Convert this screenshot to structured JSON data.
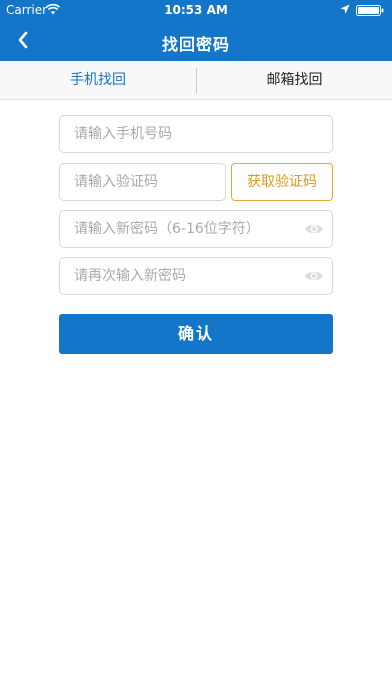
{
  "status_bar": {
    "carrier": "Carrier",
    "time": "10:53 AM",
    "icons": [
      "wifi-icon",
      "location-arrow-icon",
      "battery-icon"
    ]
  },
  "nav": {
    "title": "找回密码",
    "back_icon": "chevron-left-icon"
  },
  "tabs": [
    {
      "label": "手机找回",
      "active": true
    },
    {
      "label": "邮箱找回",
      "active": false
    }
  ],
  "form": {
    "phone_placeholder": "请输入手机号码",
    "code_placeholder": "请输入验证码",
    "get_code_label": "获取验证码",
    "new_password_placeholder": "请输入新密码（6-16位字符）",
    "confirm_password_placeholder": "请再次输入新密码",
    "confirm_label": "确认"
  },
  "colors": {
    "primary": "#1476c8",
    "accent": "#e09a1c",
    "border": "#d8d8d8"
  }
}
